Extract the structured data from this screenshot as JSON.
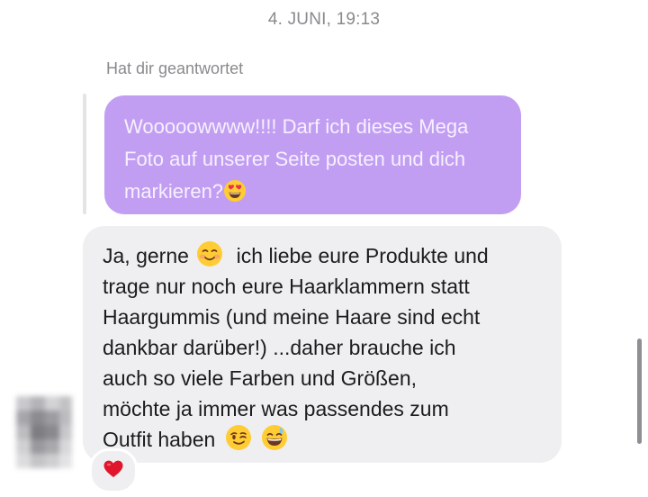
{
  "conversation": {
    "timestamp": "4. JUNI, 19:13",
    "replied_label": "Hat dir geantwortet",
    "quoted_message": {
      "lines": [
        "Wooooowwww!!!! Darf ich dieses Mega",
        "Foto auf unserer Seite posten und dich",
        "markieren?"
      ],
      "trailing_emoji": "smiling-face-with-heart-eyes"
    },
    "reply_message": {
      "line1_before_emoji": "Ja, gerne ",
      "line1_emoji": "smiling-face-blushing",
      "line1_after_emoji": " ich liebe eure Produkte und",
      "lines": [
        "trage nur noch eure Haarklammern statt",
        "Haargummis (und meine Haare sind echt",
        "dankbar darüber!) ...daher brauche ich",
        "auch so viele Farben und Größen,",
        "möchte ja immer was passendes zum"
      ],
      "last_line": "Outfit haben ",
      "last_line_emojis": [
        "winking-face",
        "grinning-face-with-sweat"
      ]
    },
    "reaction": "red-heart",
    "colors": {
      "quoted_bubble": "#c29ef3",
      "reply_bubble": "#efeff1",
      "meta_text": "#8a8a8e"
    }
  }
}
